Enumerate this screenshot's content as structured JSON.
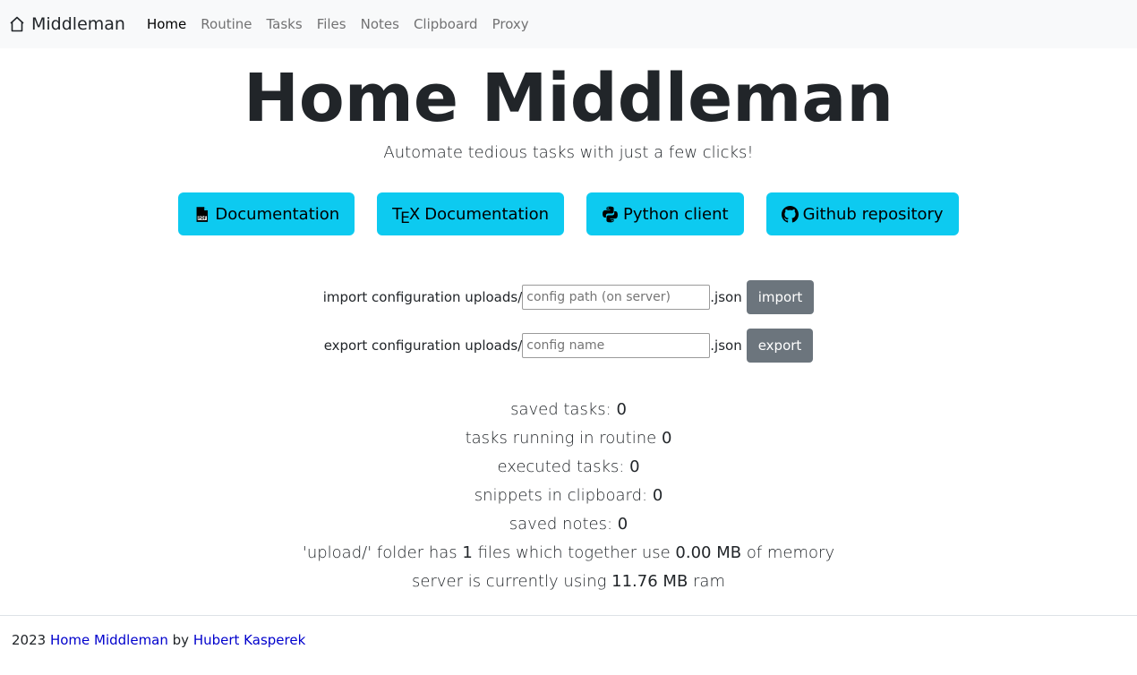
{
  "navbar": {
    "brand": "Middleman",
    "links": [
      "Home",
      "Routine",
      "Tasks",
      "Files",
      "Notes",
      "Clipboard",
      "Proxy"
    ],
    "active": "Home"
  },
  "hero": {
    "title": "Home Middleman",
    "subtitle": "Automate tedious tasks with just a few clicks!"
  },
  "buttons": {
    "documentation": "Documentation",
    "tex_t": "T",
    "tex_e": "E",
    "tex_x": "X",
    "tex_documentation": "Documentation",
    "python_client": "Python client",
    "github": "Github repository",
    "color": "#0dcaf0"
  },
  "import_config": {
    "label": "import configuration uploads/",
    "placeholder": "config path (on server)",
    "suffix": ".json",
    "button": "import"
  },
  "export_config": {
    "label": "export configuration uploads/",
    "placeholder": "config name",
    "suffix": ".json",
    "button": "export"
  },
  "stats": {
    "saved_tasks_label": "saved tasks: ",
    "saved_tasks": "0",
    "running_label": "tasks running in routine ",
    "running": "0",
    "executed_label": "executed tasks: ",
    "executed": "0",
    "snippets_label": "snippets in clipboard: ",
    "snippets": "0",
    "notes_label": "saved notes: ",
    "notes": "0",
    "upload_prefix": "'upload/' folder has ",
    "upload_files": "1",
    "upload_mid": " files which together use ",
    "upload_size": "0.00 MB",
    "upload_suffix": " of memory",
    "server_prefix": "server is currently using ",
    "server_ram": "11.76 MB",
    "server_suffix": " ram"
  },
  "footer": {
    "year": "2023 ",
    "project": "Home Middleman",
    "by": " by ",
    "author": "Hubert Kasperek"
  }
}
